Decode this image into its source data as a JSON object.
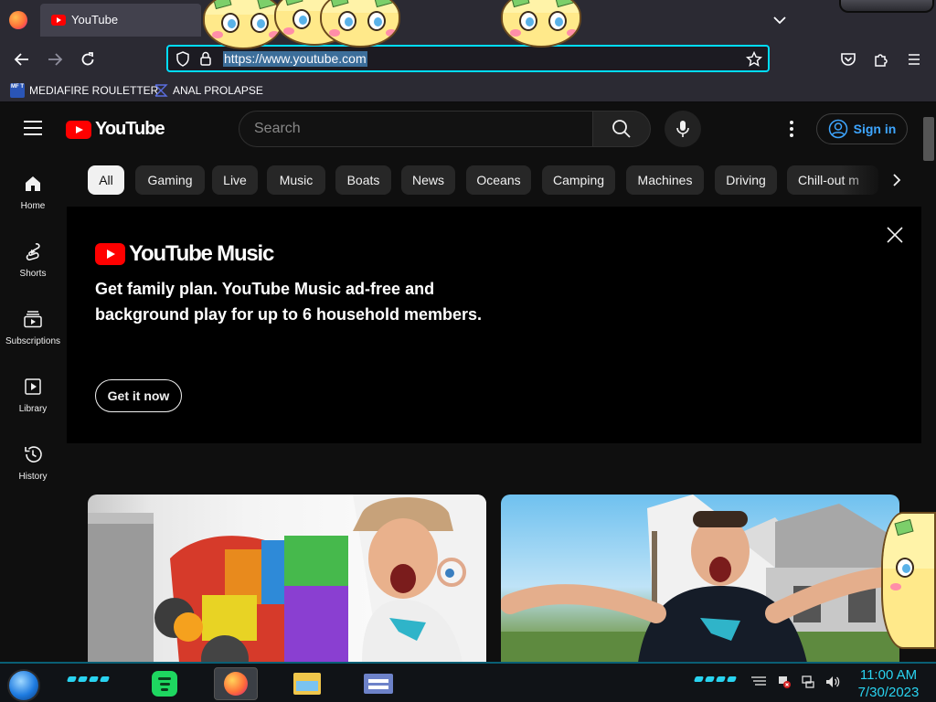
{
  "browser": {
    "tab_title": "YouTube",
    "url": "https://www.youtube.com",
    "bookmarks": [
      {
        "label": "MEDIAFIRE ROULETTER",
        "icon_text": "MF T"
      },
      {
        "label": "ANAL PROLAPSE"
      }
    ]
  },
  "youtube": {
    "logo_text": "YouTube",
    "search_placeholder": "Search",
    "signin_label": "Sign in",
    "sidebar": [
      {
        "label": "Home",
        "icon": "home-icon"
      },
      {
        "label": "Shorts",
        "icon": "shorts-icon"
      },
      {
        "label": "Subscriptions",
        "icon": "subscriptions-icon"
      },
      {
        "label": "Library",
        "icon": "library-icon"
      },
      {
        "label": "History",
        "icon": "history-icon"
      }
    ],
    "chips": [
      "All",
      "Gaming",
      "Live",
      "Music",
      "Boats",
      "News",
      "Oceans",
      "Camping",
      "Machines",
      "Driving",
      "Chill-out m"
    ],
    "selected_chip": "All",
    "promo": {
      "logo_text": "YouTube Music",
      "headline": "Get family plan. YouTube Music ad-free and background play for up to 6 household members.",
      "cta": "Get it now"
    }
  },
  "taskbar": {
    "time": "11:00 AM",
    "date": "7/30/2023",
    "apps": [
      "spotify-icon",
      "firefox-icon",
      "file-explorer-icon",
      "app-icon"
    ]
  },
  "colors": {
    "yt_red": "#ff0000",
    "background": "#0f0f0f",
    "link_blue": "#3ea6ff",
    "url_focus": "#00ddff",
    "clock_cyan": "#29d3f0"
  }
}
